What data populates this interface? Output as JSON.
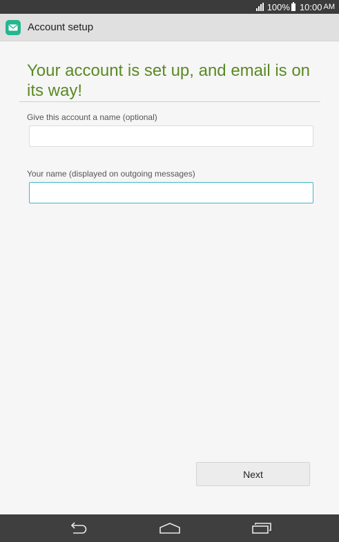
{
  "status_bar": {
    "battery": "100%",
    "time": "10:00",
    "ampm": "AM",
    "icons": [
      "signal-icon",
      "battery-icon"
    ]
  },
  "action_bar": {
    "title": "Account setup",
    "icon": "email-app-icon",
    "accent_color": "#24b68f"
  },
  "headline": {
    "text": "Your account is set up, and email is on its way!",
    "color": "#5a8a23"
  },
  "form": {
    "account_name": {
      "label": "Give this account a name (optional)",
      "value": ""
    },
    "your_name": {
      "label": "Your name (displayed on outgoing messages)",
      "value": "",
      "focused": true
    }
  },
  "actions": {
    "next_label": "Next"
  },
  "nav_bar": {
    "icons": [
      "back-icon",
      "home-icon",
      "recent-apps-icon"
    ]
  }
}
